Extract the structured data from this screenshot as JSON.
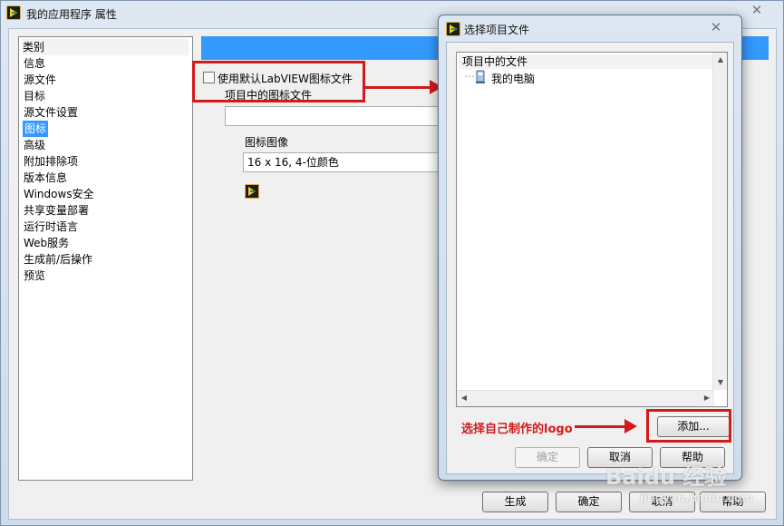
{
  "main_window": {
    "title": "我的应用程序 属性",
    "close_label": "✕"
  },
  "categories": {
    "header": "类别",
    "items": [
      "信息",
      "源文件",
      "目标",
      "源文件设置",
      "图标",
      "高级",
      "附加排除项",
      "版本信息",
      "Windows安全",
      "共享变量部署",
      "运行时语言",
      "Web服务",
      "生成前/后操作",
      "预览"
    ],
    "selected_index": 4
  },
  "icon_panel": {
    "use_default_label": "使用默认LabVIEW图标文件",
    "project_icon_label": "项目中的图标文件",
    "icon_path_value": "",
    "icon_image_label": "图标图像",
    "icon_image_value": "16 x 16, 4-位颜色"
  },
  "main_buttons": {
    "build": "生成",
    "ok": "确定",
    "cancel": "取消",
    "help": "帮助"
  },
  "dialog": {
    "title": "选择项目文件",
    "close_label": "✕",
    "tree_header": "项目中的文件",
    "tree_item": "我的电脑",
    "add_button": "添加...",
    "ok_button": "确定",
    "cancel_button": "取消",
    "help_button": "帮助"
  },
  "annotation": {
    "text": "选择自己制作的logo"
  },
  "watermark": {
    "brand": "Baidu 经验",
    "url": "jingyan.baidu.com"
  },
  "colors": {
    "accent": "#3399ff",
    "annotation_red": "#d31a1a"
  }
}
